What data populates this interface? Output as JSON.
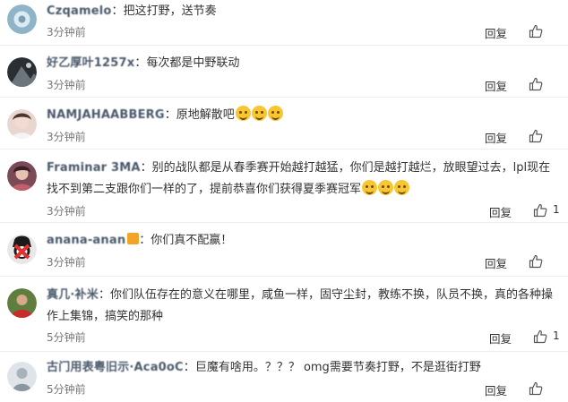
{
  "comments": [
    {
      "user": "Czqamelo",
      "colon": "：",
      "text": "把这打野，送节奏",
      "time": "3分钟前",
      "reply": "回复",
      "likes": ""
    },
    {
      "user": "好乙厚叶1257x",
      "colon": "：",
      "text": "每次都是中野联动",
      "time": "3分钟前",
      "reply": "回复",
      "likes": ""
    },
    {
      "user": "NAMJAHAABBERG",
      "colon": "：",
      "text": "原地解散吧",
      "time": "3分钟前",
      "reply": "回复",
      "likes": ""
    },
    {
      "user": "Framinar 3MA",
      "colon": "：",
      "text": "别的战队都是从春季赛开始越打越猛，你们是越打越烂，放眼望过去，lpl现在找不到第二支跟你们一样的了，提前恭喜你们获得夏季赛冠军",
      "time": "3分钟前",
      "reply": "回复",
      "likes": "1"
    },
    {
      "user": "anana-anan",
      "colon": "：",
      "text": "你们真不配赢！",
      "time": "3分钟前",
      "reply": "回复",
      "likes": ""
    },
    {
      "user": "真几·补米",
      "colon": "：",
      "text": "你们队伍存在的意义在哪里，咸鱼一样，固守尘封，教练不换，队员不换，真的各种操作上集锦，搞笑的那种",
      "time": "5分钟前",
      "reply": "回复",
      "likes": "1"
    },
    {
      "user": "古门用表粤旧示·Aca0oC",
      "colon": "：",
      "text": "巨魔有啥用。？？？ omg需要节奏打野，不是逛街打野",
      "time": "5分钟前",
      "reply": "回复",
      "likes": ""
    }
  ],
  "icons": {
    "like": "thumbs-up-icon",
    "vip": "vip-badge-icon",
    "emoji": "laughing-emoji-icon"
  }
}
